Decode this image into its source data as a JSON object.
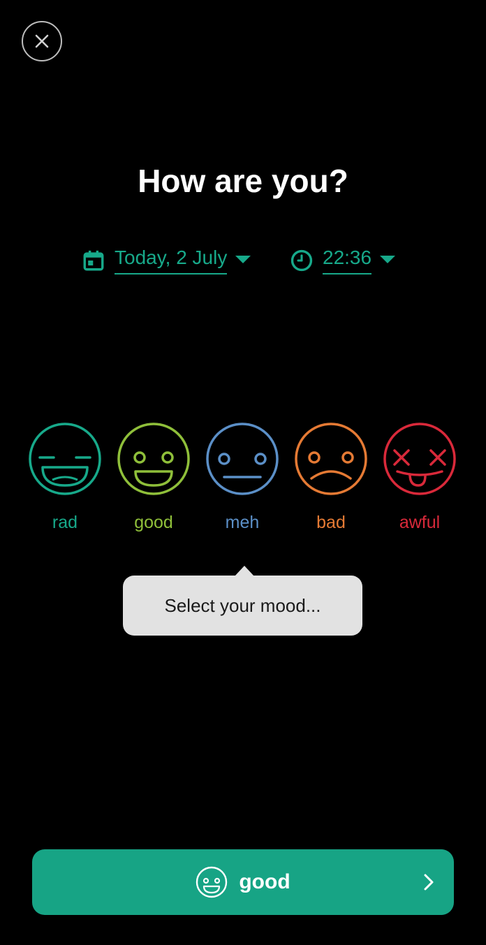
{
  "header": {
    "title": "How are you?"
  },
  "date_picker": {
    "value": "Today, 2 July",
    "icon": "calendar-icon"
  },
  "time_picker": {
    "value": "22:36",
    "icon": "clock-icon"
  },
  "moods": [
    {
      "id": "rad",
      "label": "rad",
      "color": "#17a98a"
    },
    {
      "id": "good",
      "label": "good",
      "color": "#8fbf3a"
    },
    {
      "id": "meh",
      "label": "meh",
      "color": "#5b8fc7"
    },
    {
      "id": "bad",
      "label": "bad",
      "color": "#e57a34"
    },
    {
      "id": "awful",
      "label": "awful",
      "color": "#d9293a"
    }
  ],
  "tooltip": {
    "text": "Select your mood..."
  },
  "confirm_button": {
    "label": "good",
    "icon": "smiley-icon"
  },
  "colors": {
    "accent": "#17a98a",
    "background": "#000000",
    "button": "#17a485"
  }
}
